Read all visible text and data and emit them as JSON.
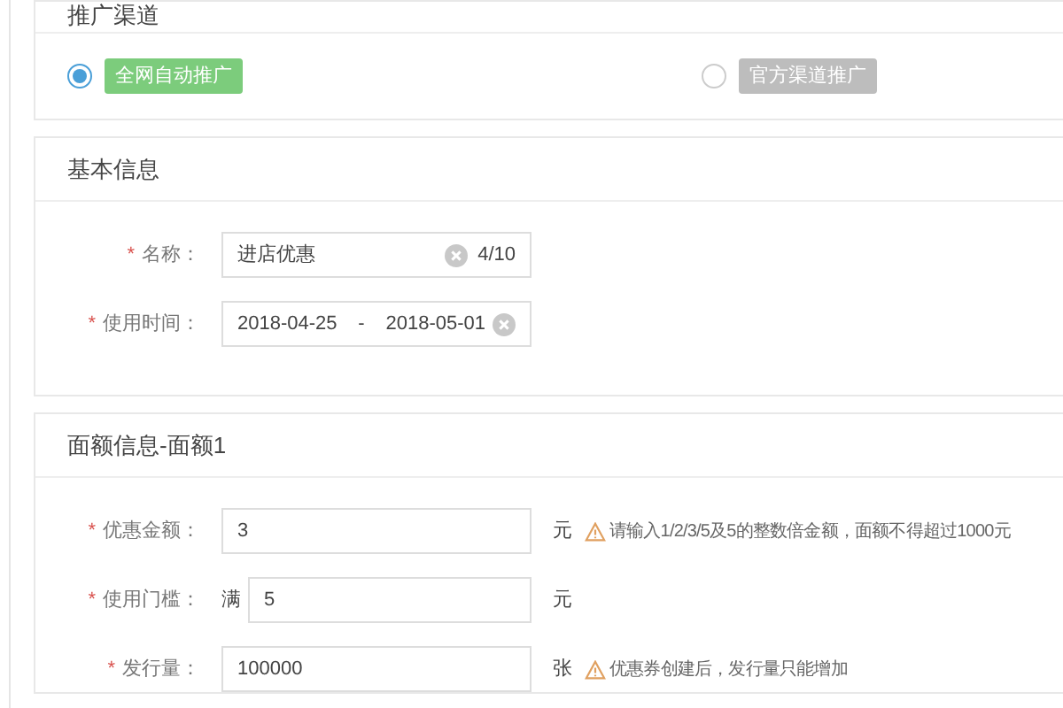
{
  "promotion_section": {
    "title": "推广渠道",
    "options": [
      {
        "label": "全网自动推广",
        "selected": true
      },
      {
        "label": "官方渠道推广",
        "selected": false
      }
    ]
  },
  "basic_section": {
    "title": "基本信息",
    "fields": [
      {
        "kind": "text",
        "label": "名称：",
        "required_mark": "*",
        "value": "进店优惠",
        "counter": "4/10"
      },
      {
        "kind": "daterange",
        "label": "使用时间：",
        "required_mark": "*",
        "start": "2018-04-25",
        "separator": "-",
        "end": "2018-05-01"
      }
    ]
  },
  "amount_section": {
    "title": "面额信息-面额1",
    "fields": [
      {
        "label": "优惠金额：",
        "required_mark": "*",
        "value": "3",
        "unit": "元",
        "warning": "请输入1/2/3/5及5的整数倍金额，面额不得超过1000元"
      },
      {
        "label": "使用门槛：",
        "required_mark": "*",
        "prefix": "满",
        "value": "5",
        "unit": "元"
      },
      {
        "label": "发行量：",
        "required_mark": "*",
        "value": "100000",
        "unit": "张",
        "warning": "优惠券创建后，发行量只能增加"
      }
    ]
  }
}
